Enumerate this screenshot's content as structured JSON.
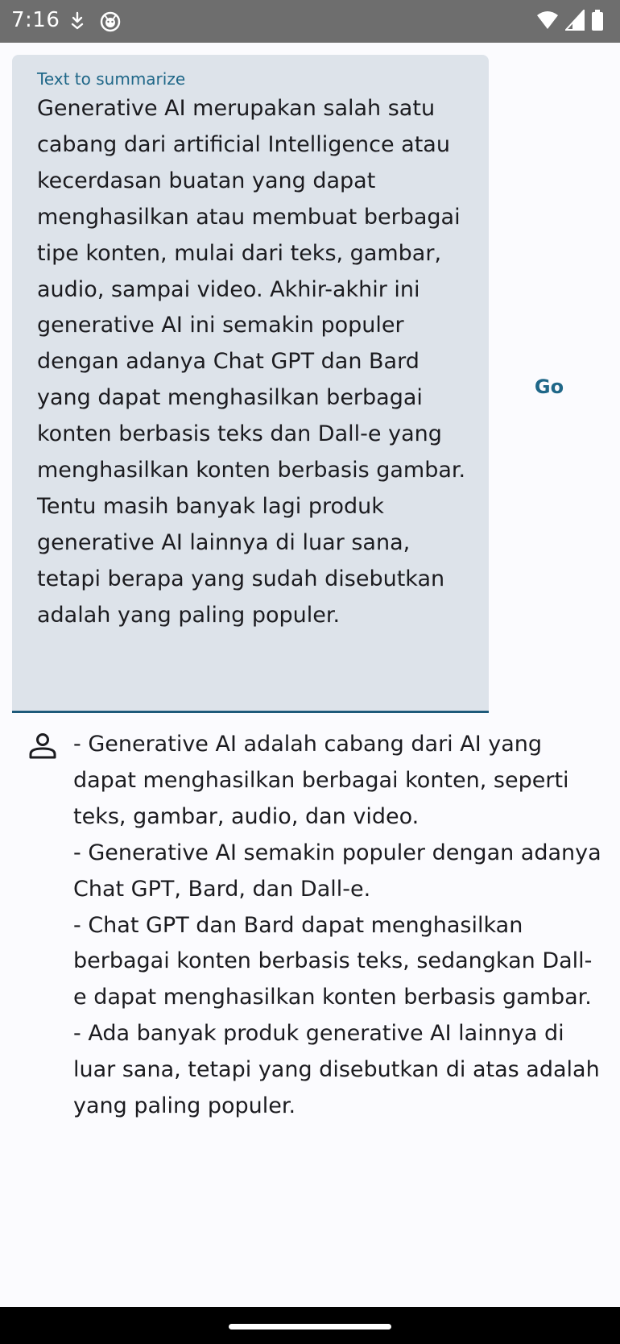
{
  "status_bar": {
    "time": "7:16",
    "icons_left": [
      "download-icon",
      "app-notification-icon"
    ],
    "icons_right": [
      "wifi-icon",
      "cell-signal-icon",
      "battery-icon"
    ]
  },
  "input": {
    "label": "Text to summarize",
    "value": "Generative AI merupakan salah satu cabang dari artificial Intelligence atau kecerdasan buatan yang dapat menghasilkan atau membuat berbagai tipe konten, mulai dari teks, gambar, audio, sampai video. Akhir-akhir ini generative AI ini semakin populer dengan adanya Chat GPT dan Bard yang dapat menghasilkan berbagai konten berbasis teks dan Dall-e yang menghasilkan konten berbasis gambar. Tentu masih banyak lagi produk generative AI lainnya di luar sana, tetapi berapa yang sudah disebutkan adalah yang paling populer."
  },
  "go_button": {
    "label": "Go"
  },
  "result": {
    "icon": "person-icon",
    "lines": [
      "- Generative AI adalah cabang dari AI yang dapat menghasilkan berbagai konten, seperti teks, gambar, audio, dan video.",
      "- Generative AI semakin populer dengan adanya Chat GPT, Bard, dan Dall-e.",
      "- Chat GPT dan Bard dapat menghasilkan berbagai konten berbasis teks, sedangkan Dall-e dapat menghasilkan konten berbasis gambar.",
      "- Ada banyak produk generative AI lainnya di luar sana, tetapi yang disebutkan di atas adalah yang paling populer."
    ]
  },
  "colors": {
    "status_bar": "#6E6E6E",
    "field_background": "#DDE3EA",
    "accent": "#1F6788",
    "underline": "#1E5A7A",
    "background": "#FBFBFE"
  }
}
